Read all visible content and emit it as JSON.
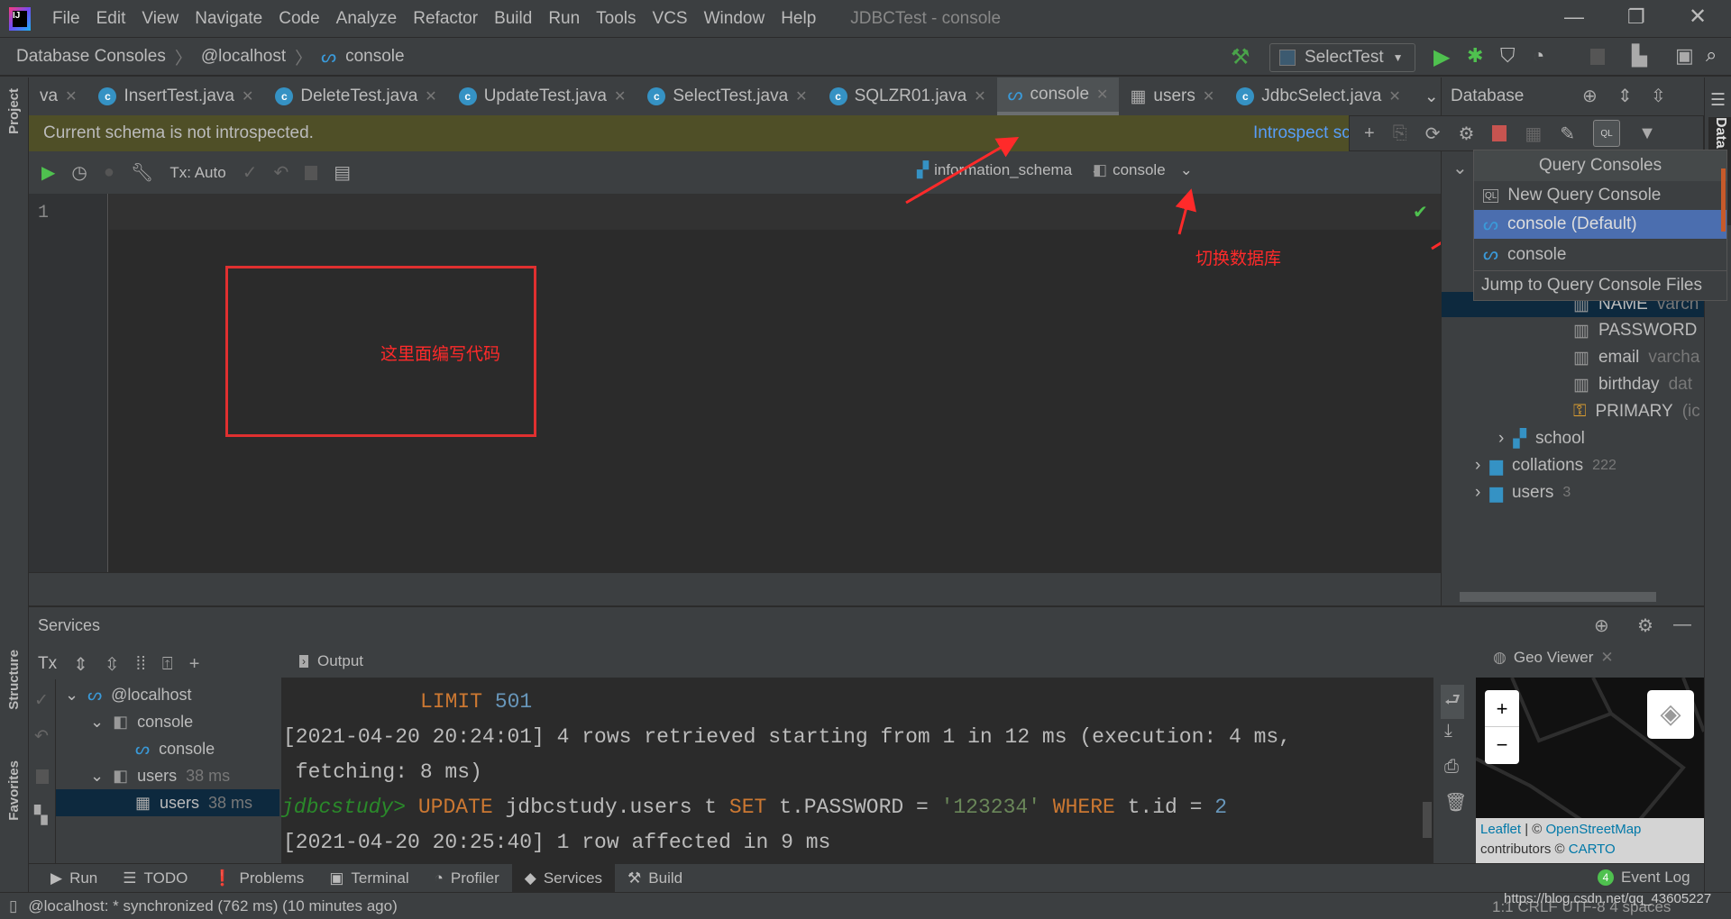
{
  "window": {
    "title": "JDBCTest - console",
    "menu": [
      "File",
      "Edit",
      "View",
      "Navigate",
      "Code",
      "Analyze",
      "Refactor",
      "Build",
      "Run",
      "Tools",
      "VCS",
      "Window",
      "Help"
    ]
  },
  "breadcrumb": [
    "Database Consoles",
    "@localhost",
    "console"
  ],
  "run_config": "SelectTest",
  "tabs": [
    {
      "label": "va"
    },
    {
      "label": "InsertTest.java"
    },
    {
      "label": "DeleteTest.java"
    },
    {
      "label": "UpdateTest.java"
    },
    {
      "label": "SelectTest.java"
    },
    {
      "label": "SQLZR01.java"
    },
    {
      "label": "console",
      "active": true
    },
    {
      "label": "users"
    },
    {
      "label": "JdbcSelect.java"
    }
  ],
  "banner": {
    "text": "Current schema is not introspected.",
    "link": "Introspect sc"
  },
  "editor_toolbar": {
    "tx": "Tx: Auto",
    "schema": "information_schema",
    "session": "console"
  },
  "editor": {
    "line_numbers": [
      "1"
    ]
  },
  "annotations": {
    "edit_here": "这里面编写代码",
    "switch_db": "切换数据库",
    "color": "#ff2a2a"
  },
  "database_panel": {
    "title": "Database",
    "tree": [
      {
        "label": "NAME",
        "meta": "varch"
      },
      {
        "label": "PASSWORD",
        "meta": ""
      },
      {
        "label": "email",
        "meta": "varcha"
      },
      {
        "label": "birthday",
        "meta": "dat"
      },
      {
        "label": "PRIMARY",
        "meta": "(ic"
      },
      {
        "label": "school",
        "meta": ""
      },
      {
        "label": "collations",
        "meta": "222"
      },
      {
        "label": "users",
        "meta": "3"
      }
    ]
  },
  "query_consoles_menu": {
    "title": "Query Consoles",
    "items": [
      "New Query Console",
      "console (Default)",
      "console",
      "Jump to Query Console Files"
    ]
  },
  "right_strip": {
    "label": "Data"
  },
  "left_strip": {
    "project": "Project",
    "structure": "Structure",
    "favorites": "Favorites"
  },
  "services": {
    "title": "Services",
    "tx": "Tx",
    "output_tab": "Output",
    "tree": [
      {
        "label": "@localhost",
        "meta": ""
      },
      {
        "label": "console",
        "meta": ""
      },
      {
        "label": "console",
        "meta": ""
      },
      {
        "label": "users",
        "meta": "38 ms"
      },
      {
        "label": "users",
        "meta": "38 ms"
      }
    ],
    "output": {
      "l1_kw": "LIMIT",
      "l1_num": "501",
      "l2": "[2021-04-20 20:24:01] 4 rows retrieved starting from 1 in 12 ms (execution: 4 ms,",
      "l3": " fetching: 8 ms)",
      "l4_prompt": "jdbcstudy>",
      "l4_a": "UPDATE",
      "l4_b": " jdbcstudy.users t ",
      "l4_c": "SET",
      "l4_d": " t.PASSWORD = ",
      "l4_e": "'123234'",
      "l4_f": " WHERE",
      "l4_g": " t.id = ",
      "l4_h": "2",
      "l5": "[2021-04-20 20:25:40] 1 row affected in 9 ms"
    }
  },
  "geo_viewer": {
    "title": "Geo Viewer",
    "zoom_in": "+",
    "zoom_out": "−",
    "attr_leaflet": "Leaflet",
    "attr_sep": " | © ",
    "attr_osm": "OpenStreetMap",
    "attr_contrib": "contributors © ",
    "attr_carto": "CARTO"
  },
  "bottom_tabs": [
    "Run",
    "TODO",
    "Problems",
    "Terminal",
    "Profiler",
    "Services",
    "Build"
  ],
  "event_log": {
    "count": "4",
    "label": "Event Log"
  },
  "status": {
    "text": "@localhost: * synchronized (762 ms) (10 minutes ago)",
    "right": "1:1  CRLF  UTF-8  4 spaces",
    "watermark": "https://blog.csdn.net/qq_43605227"
  }
}
